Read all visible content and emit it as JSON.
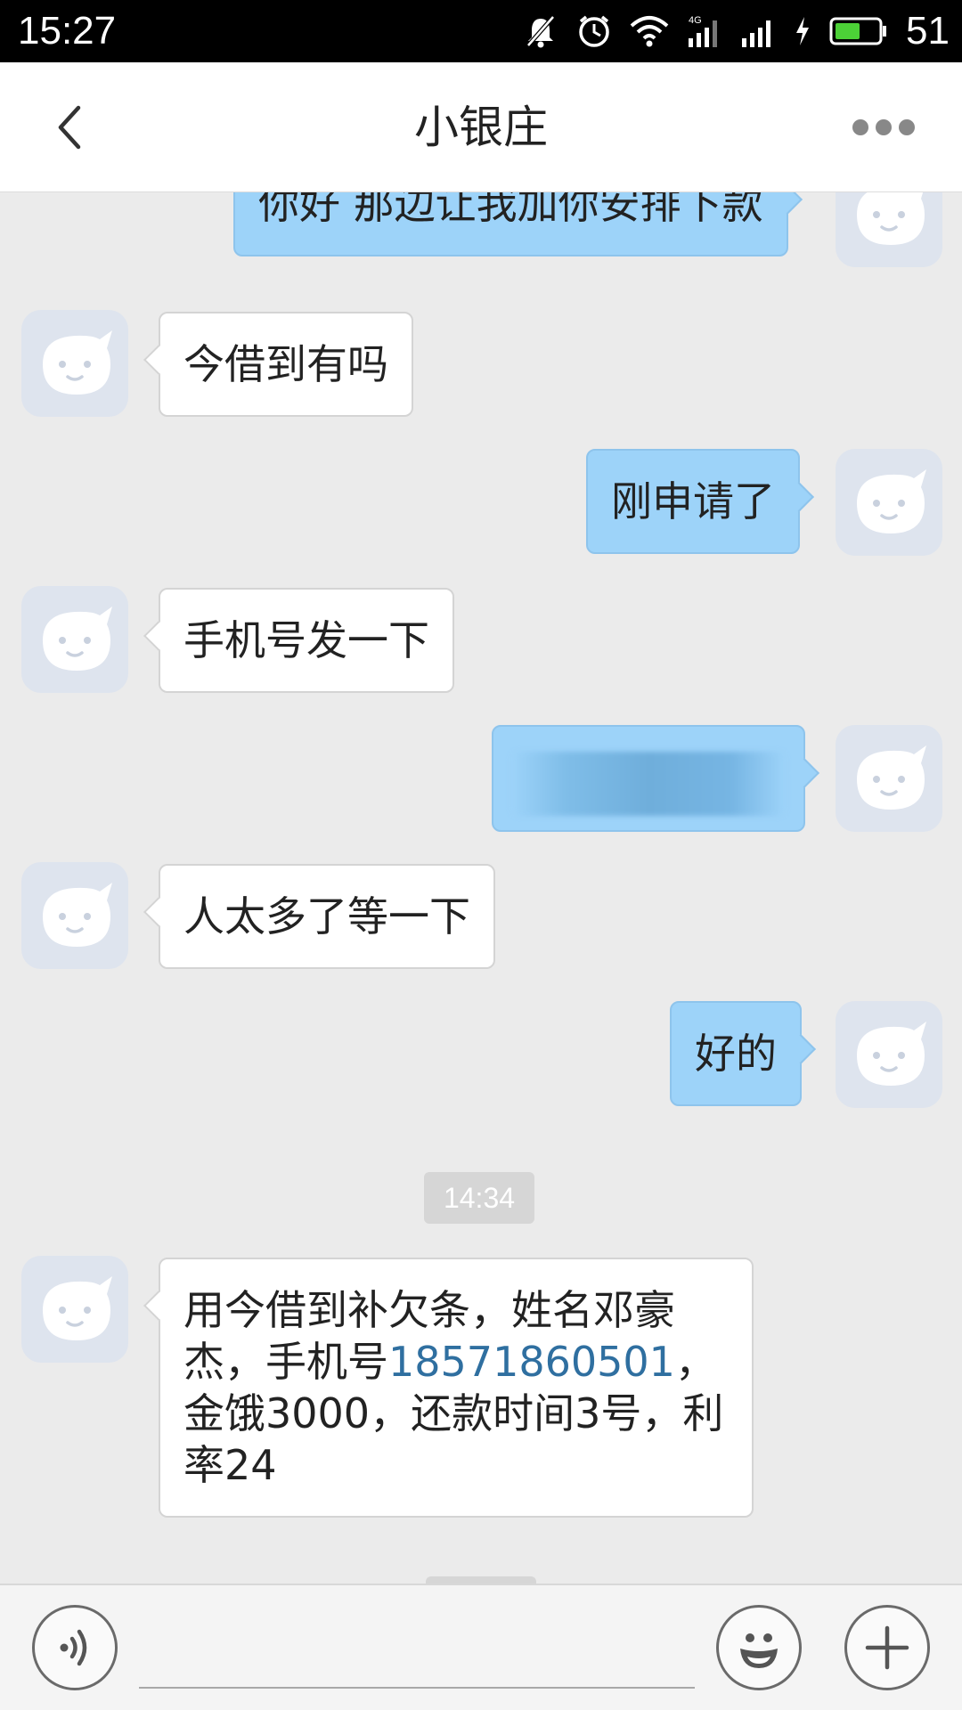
{
  "status_bar": {
    "time": "15:27",
    "battery_level": "51",
    "icons": [
      "mute-icon",
      "alarm-icon",
      "wifi-icon",
      "signal-4g-icon",
      "signal-icon",
      "charging-icon",
      "battery-icon"
    ]
  },
  "header": {
    "title": "小银庄",
    "back_icon": "chevron-left-icon",
    "more_icon": "more-dots-icon"
  },
  "messages": [
    {
      "direction": "out",
      "text": "你好 那边让我加你安排下款"
    },
    {
      "direction": "in",
      "text": "今借到有吗"
    },
    {
      "direction": "out",
      "text": "刚申请了"
    },
    {
      "direction": "in",
      "text": "手机号发一下"
    },
    {
      "direction": "out",
      "text": "",
      "blurred": true
    },
    {
      "direction": "in",
      "text": "人太多了等一下"
    },
    {
      "direction": "out",
      "text": "好的"
    },
    {
      "direction": "in",
      "text_parts": [
        "用今借到补欠条，姓名邓豪杰，手机号",
        "18571860501",
        "，金饿3000，还款时间3号，利率24"
      ],
      "link": "18571860501"
    }
  ],
  "timestamp": "14:34",
  "input_bar": {
    "voice_icon": "voice-icon",
    "emoji_icon": "emoji-icon",
    "plus_icon": "plus-icon",
    "placeholder": ""
  },
  "colors": {
    "outgoing_bubble": "#9dd3f9",
    "incoming_bubble": "#ffffff",
    "chat_background": "#ebebeb",
    "link": "#2f6fa0"
  }
}
